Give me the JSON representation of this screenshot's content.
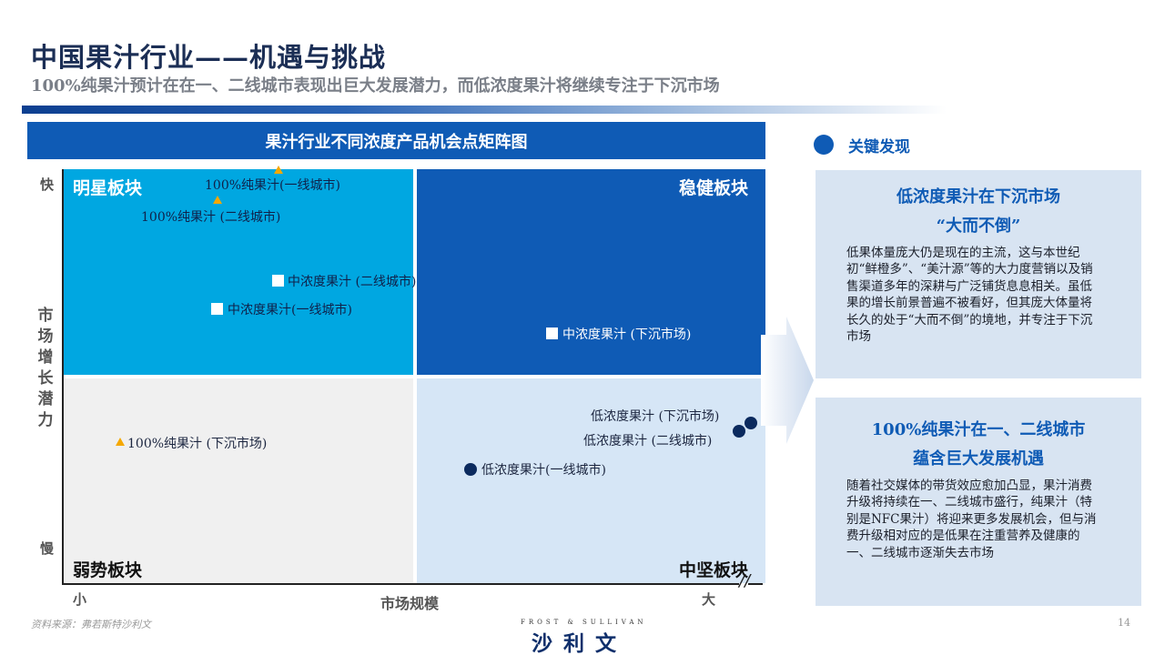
{
  "header": {
    "title": "中国果汁行业——机遇与挑战",
    "subtitle": "100%纯果汁预计在在一、二线城市表现出巨大发展潜力，而低浓度果汁将继续专注于下沉市场"
  },
  "chart": {
    "banner": "果汁行业不同浓度产品机会点矩阵图",
    "quadrants": {
      "star": "明星板块",
      "steady": "稳健板块",
      "weak": "弱势板块",
      "mid": "中坚板块"
    },
    "y_axis": {
      "fast": "快",
      "slow": "慢",
      "label": "市场增长潜力"
    },
    "x_axis": {
      "small": "小",
      "big": "大",
      "label": "市场规模"
    },
    "points": {
      "pure_tier1": "100%纯果汁(一线城市)",
      "pure_tier2": "100%纯果汁 (二线城市)",
      "mid_tier2": "中浓度果汁 (二线城市)",
      "mid_tier1": "中浓度果汁(一线城市)",
      "mid_lower": "中浓度果汁 (下沉市场)",
      "pure_lower": "100%纯果汁 (下沉市场)",
      "low_lower": "低浓度果汁 (下沉市场)",
      "low_tier2": "低浓度果汁 (二线城市)",
      "low_tier1": "低浓度果汁(一线城市)"
    },
    "colors": {
      "star": "#00a7e1",
      "steady": "#0f5bb5",
      "weak": "#f0f0f0",
      "mid": "#d6e6f6",
      "triangle": "#f5a800",
      "dot": "#0b2a5e"
    }
  },
  "findings": {
    "title": "关键发现",
    "card1": {
      "heading_line1": "低浓度果汁在下沉市场",
      "heading_line2": "“大而不倒”",
      "body": "低果体量庞大仍是现在的主流，这与本世纪初“鲜橙多”、“美汁源”等的大力度营销以及销售渠道多年的深耕与广泛铺货息息相关。虽低果的增长前景普遍不被看好，但其庞大体量将长久的处于“大而不倒”的境地，并专注于下沉市场"
    },
    "card2": {
      "heading_line1": "100%纯果汁在一、二线城市",
      "heading_line2": "蕴含巨大发展机遇",
      "body": "随着社交媒体的带货效应愈加凸显，果汁消费升级将持续在一、二线城市盛行，纯果汁（特别是NFC果汁）将迎来更多发展机会，但与消费升级相对应的是低果在注重营养及健康的一、二线城市逐渐失去市场"
    }
  },
  "footer": {
    "source": "资料来源：弗若斯特沙利文",
    "logo_sub": "FROST & SULLIVAN",
    "logo_main": "沙利文",
    "page": "14"
  }
}
